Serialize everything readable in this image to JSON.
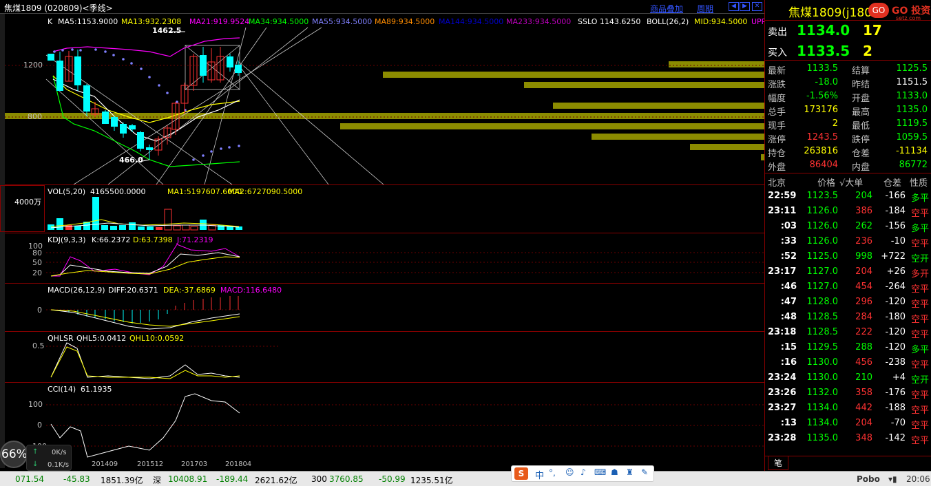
{
  "header": {
    "title": "焦煤1809 (020809)<季线>",
    "link_overlay": "商品叠加",
    "link_period": "周期",
    "logo_text": "焦煤1809(j1809)",
    "brand": "GO 投资",
    "brand_sub": "setz.com"
  },
  "colors": {
    "up": "#ff3232",
    "down": "#00ffff",
    "green": "#00ff00",
    "yellow": "#ffff00",
    "white": "#ffffff",
    "magenta": "#ff00ff",
    "volume_profile": "#8b8b00"
  },
  "ma_line": {
    "k": "K",
    "ma5": "MA5:1153.9000",
    "ma13": "MA13:932.2308",
    "ma21": "MA21:919.9524",
    "ma34": "MA34:934.5000",
    "ma55": "MA55:934.5000",
    "ma89": "MA89:934.5000",
    "ma144": "MA144:934.5000",
    "ma233": "MA233:934.5000",
    "sslo": "SSLO 1143.6250",
    "boll": "BOLL(26,2)",
    "mid": "MID:934.5000",
    "upper": "UPP"
  },
  "main_axis": {
    "t1200": "1200",
    "t800": "800",
    "hi": "1462.5",
    "lo": "466.0"
  },
  "vol": {
    "title": "VOL(5,20)",
    "val": "4165500.0000",
    "ma1": "MA1:5197607.6000",
    "ma2": "MA2:6727090.5000",
    "axis": "4000万"
  },
  "kdj": {
    "title": "KDJ(9,3,3)",
    "k": "K:66.2372",
    "d": "D:63.7398",
    "j": "J:71.2319",
    "t100": "100",
    "t80": "80",
    "t50": "50",
    "t20": "20"
  },
  "macd": {
    "title": "MACD(26,12,9)",
    "diff": "DIFF:20.6371",
    "dea": "DEA:-37.6869",
    "macd": "MACD:116.6480",
    "t0": "0"
  },
  "qhlsr": {
    "title": "QHLSR",
    "q5": "QHL5:0.0412",
    "q10": "QHL10:0.0592",
    "t05": "0.5"
  },
  "cci": {
    "title": "CCI(14)",
    "val": "61.1935",
    "t100": "100",
    "t0": "0",
    "tn100": "-100"
  },
  "dates": [
    "201409",
    "201512",
    "201703",
    "201804"
  ],
  "quote": {
    "sell_label": "卖出",
    "sell_price": "1134.0",
    "sell_vol": "17",
    "buy_label": "买入",
    "buy_price": "1133.5",
    "buy_vol": "2",
    "rows": [
      {
        "l1": "最新",
        "v1": "1133.5",
        "l2": "结算",
        "v2": "1125.5",
        "c1": "#00ff00",
        "c2": "#00ff00"
      },
      {
        "l1": "涨跌",
        "v1": "-18.0",
        "l2": "昨结",
        "v2": "1151.5",
        "c1": "#00ff00",
        "c2": "#ffffff"
      },
      {
        "l1": "幅度",
        "v1": "-1.56%",
        "l2": "开盘",
        "v2": "1133.0",
        "c1": "#00ff00",
        "c2": "#00ff00"
      },
      {
        "l1": "总手",
        "v1": "173176",
        "l2": "最高",
        "v2": "1135.0",
        "c1": "#ffff00",
        "c2": "#00ff00"
      },
      {
        "l1": "现手",
        "v1": "2",
        "l2": "最低",
        "v2": "1119.5",
        "c1": "#ffff00",
        "c2": "#00ff00"
      },
      {
        "l1": "涨停",
        "v1": "1243.5",
        "l2": "跌停",
        "v2": "1059.5",
        "c1": "#ff3232",
        "c2": "#00ff00"
      },
      {
        "l1": "持仓",
        "v1": "263816",
        "l2": "仓差",
        "v2": "-11134",
        "c1": "#ffff00",
        "c2": "#ffff00"
      },
      {
        "l1": "外盘",
        "v1": "86404",
        "l2": "内盘",
        "v2": "86772",
        "c1": "#ff3232",
        "c2": "#00ff00"
      }
    ]
  },
  "trades": {
    "headers": {
      "city": "北京",
      "price": "价格",
      "big": "√大单",
      "diff": "仓差",
      "nature": "性质"
    },
    "rows": [
      {
        "t": "22:59",
        "p": "1123.5",
        "v": "204",
        "d": "-166",
        "n": "多平",
        "vc": "#00ff00",
        "nc": "#00ff00"
      },
      {
        "t": "23:11",
        "p": "1126.0",
        "v": "386",
        "d": "-184",
        "n": "空平",
        "vc": "#ff3232",
        "nc": "#ff3232"
      },
      {
        "t": ":03",
        "p": "1126.0",
        "v": "262",
        "d": "-156",
        "n": "多平",
        "vc": "#00ff00",
        "nc": "#00ff00"
      },
      {
        "t": ":33",
        "p": "1126.0",
        "v": "236",
        "d": "-10",
        "n": "空平",
        "vc": "#ff3232",
        "nc": "#ff3232"
      },
      {
        "t": ":52",
        "p": "1125.0",
        "v": "998",
        "d": "+722",
        "n": "空开",
        "vc": "#00ff00",
        "nc": "#00ff00"
      },
      {
        "t": "23:17",
        "p": "1127.0",
        "v": "204",
        "d": "+26",
        "n": "多开",
        "vc": "#ff3232",
        "nc": "#ff3232"
      },
      {
        "t": ":46",
        "p": "1127.0",
        "v": "454",
        "d": "-264",
        "n": "空平",
        "vc": "#ff3232",
        "nc": "#ff3232"
      },
      {
        "t": ":47",
        "p": "1128.0",
        "v": "296",
        "d": "-120",
        "n": "空平",
        "vc": "#ff3232",
        "nc": "#ff3232"
      },
      {
        "t": ":48",
        "p": "1128.5",
        "v": "284",
        "d": "-180",
        "n": "空平",
        "vc": "#ff3232",
        "nc": "#ff3232"
      },
      {
        "t": "23:18",
        "p": "1128.5",
        "v": "222",
        "d": "-120",
        "n": "空平",
        "vc": "#ff3232",
        "nc": "#ff3232"
      },
      {
        "t": ":15",
        "p": "1129.5",
        "v": "288",
        "d": "-120",
        "n": "多平",
        "vc": "#00ff00",
        "nc": "#00ff00"
      },
      {
        "t": ":16",
        "p": "1130.0",
        "v": "456",
        "d": "-238",
        "n": "空平",
        "vc": "#ff3232",
        "nc": "#ff3232"
      },
      {
        "t": "23:24",
        "p": "1130.0",
        "v": "210",
        "d": "+4",
        "n": "空开",
        "vc": "#00ff00",
        "nc": "#00ff00"
      },
      {
        "t": "23:26",
        "p": "1132.0",
        "v": "358",
        "d": "-176",
        "n": "空平",
        "vc": "#ff3232",
        "nc": "#ff3232"
      },
      {
        "t": "23:27",
        "p": "1134.0",
        "v": "442",
        "d": "-188",
        "n": "空平",
        "vc": "#ff3232",
        "nc": "#ff3232"
      },
      {
        "t": ":13",
        "p": "1134.0",
        "v": "204",
        "d": "-70",
        "n": "空平",
        "vc": "#ff3232",
        "nc": "#ff3232"
      },
      {
        "t": "23:28",
        "p": "1135.0",
        "v": "348",
        "d": "-142",
        "n": "空平",
        "vc": "#ff3232",
        "nc": "#ff3232"
      }
    ],
    "tab": "笔"
  },
  "status": {
    "sh_idx": "071.54",
    "sh_chg": "-45.83",
    "sh_amt": "1851.39亿",
    "sz_name": "深",
    "sz_idx": "10408.91",
    "sz_chg": "-189.44",
    "sz_amt": "2621.62亿",
    "hs_name": "300",
    "hs_idx": "3760.85",
    "hs_chg": "-50.99",
    "hs_amt": "1235.51亿",
    "pobo": "Pobo",
    "time": "20:06"
  },
  "widget": {
    "gauge": "66%",
    "up": "0K/s",
    "down": "0.1K/s"
  },
  "chart_data": {
    "type": "candlestick",
    "title": "焦煤1809 (020809)<季线>",
    "x": [
      "201409",
      "201512",
      "201703",
      "201804"
    ],
    "ylabels": [
      "800",
      "1200"
    ],
    "high_mark": 1462.5,
    "low_mark": 466.0,
    "volume_profile_levels": [
      1200,
      1180,
      1150,
      1100,
      1050,
      1000,
      950,
      900,
      870,
      840,
      810,
      780
    ]
  }
}
